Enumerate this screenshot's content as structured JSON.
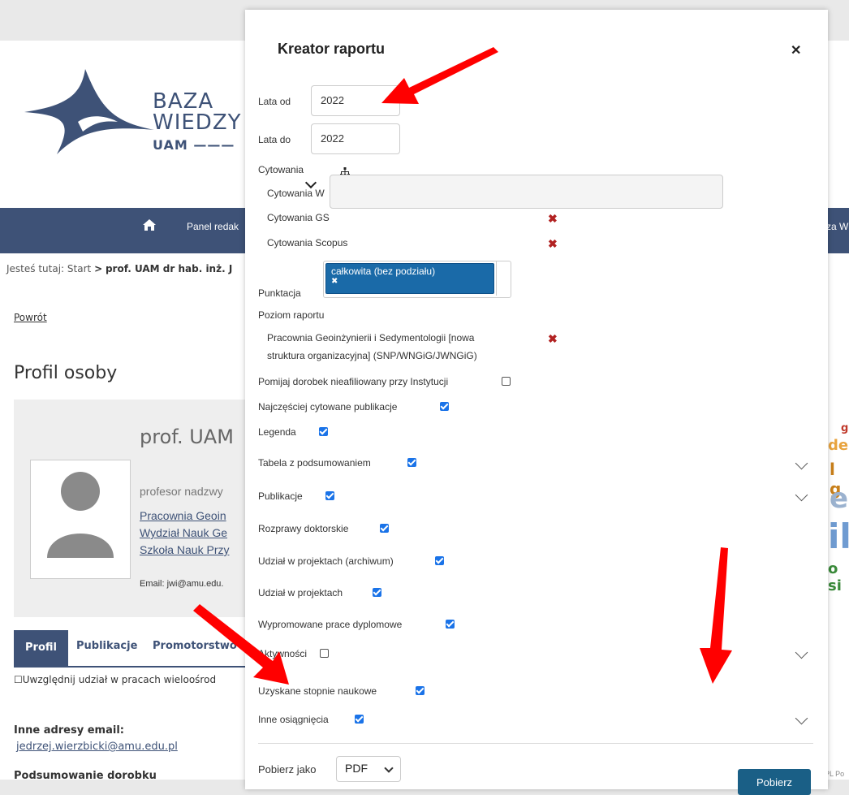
{
  "background": {
    "logo": {
      "line1": "BAZA",
      "line2": "WIEDZY",
      "line3": "UAM"
    },
    "nav": {
      "home_icon": "home-icon",
      "panel": "Panel redak",
      "right": "za W"
    },
    "breadcrumb": {
      "prefix": "Jesteś tutaj:",
      "start": "Start",
      "sep": ">",
      "person": "prof. UAM dr hab. inż. J"
    },
    "back_link": "Powrót",
    "profile_title": "Profil osoby",
    "card": {
      "name": "prof. UAM",
      "position": "profesor nadzwy",
      "link1": "Pracownia Geoin",
      "link2": "Wydział Nauk Ge",
      "link3": "Szkoła Nauk Przy",
      "email": "Email: jwi@amu.edu."
    },
    "tabs": [
      "Profil",
      "Publikacje",
      "Promotorstwo"
    ],
    "include_text": "☐Uwzględnij udział w pracach wieloośrod",
    "other_emails_label": "Inne adresy email:",
    "other_email": "jedrzej.wierzbicki@amu.edu.pl",
    "summary_label": "Podsumowanie dorobku",
    "word_cloud": [
      "g",
      "dep",
      "l g",
      "e",
      "il",
      "o si"
    ],
    "lang": "PL Po"
  },
  "modal": {
    "title": "Kreator raportu",
    "close_icon": "close-icon",
    "years_from_label": "Lata od",
    "years_from_value": "2022",
    "years_to_label": "Lata do",
    "years_to_value": "2022",
    "citations_label": "Cytowania",
    "hierarchy_icon": "hierarchy-icon",
    "citations_items": [
      "Cytowania W",
      "Cytowania GS",
      "Cytowania Scopus"
    ],
    "points_label": "Punktacja",
    "points_tag": "całkowita (bez podziału)",
    "report_level_label": "Poziom raportu",
    "report_level_line1": "Pracownia Geoinżynierii i Sedymentologii [nowa",
    "report_level_line2": "struktura organizacyjna] (SNP/WNGiG/JWNGiG)",
    "options": [
      {
        "label": "Pomijaj dorobek nieafiliowany przy Instytucji",
        "checked": false
      },
      {
        "label": "Najczęściej cytowane publikacje",
        "checked": true
      },
      {
        "label": "Legenda",
        "checked": true
      },
      {
        "label": "Tabela z podsumowaniem",
        "checked": true
      },
      {
        "label": "Publikacje",
        "checked": true
      },
      {
        "label": "Rozprawy doktorskie",
        "checked": true
      },
      {
        "label": "Udział w projektach (archiwum)",
        "checked": true
      },
      {
        "label": "Udział w projektach",
        "checked": true
      },
      {
        "label": "Wypromowane prace dyplomowe",
        "checked": true
      },
      {
        "label": "Aktywności",
        "checked": false
      },
      {
        "label": "Uzyskane stopnie naukowe",
        "checked": true
      },
      {
        "label": "Inne osiągnięcia",
        "checked": true
      }
    ],
    "download_as_label": "Pobierz jako",
    "format_value": "PDF",
    "download_button": "Pobierz"
  },
  "colors": {
    "brand": "#3e5277",
    "primary_button": "#1a5f86",
    "check_blue": "#1a73e8",
    "remove_red": "#b22222",
    "arrow_red": "#ff0000"
  }
}
